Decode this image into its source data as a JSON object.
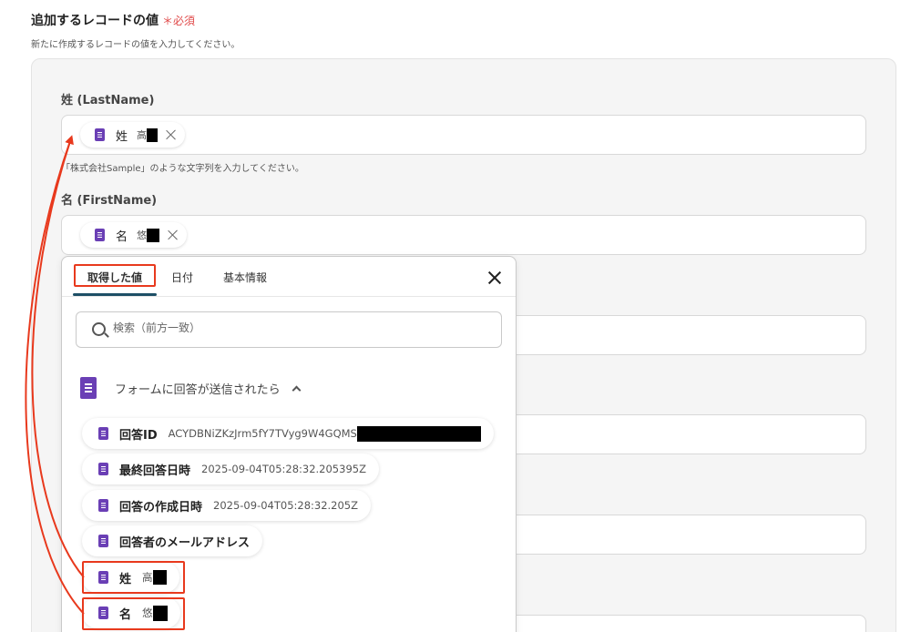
{
  "section": {
    "title": "追加するレコードの値",
    "required_mark": "＊",
    "required_label": "必須",
    "description": "新たに作成するレコードの値を入力してください。"
  },
  "fields": {
    "lastname": {
      "label": "姓 (LastName)",
      "chip_name": "姓",
      "chip_value": "高",
      "hint": "「株式会社Sample」のような文字列を入力してください。"
    },
    "firstname": {
      "label": "名 (FirstName)",
      "chip_name": "名",
      "chip_value": "悠"
    }
  },
  "popup": {
    "tabs": [
      "取得した値",
      "日付",
      "基本情報"
    ],
    "active_tab": "取得した値",
    "search_placeholder": "検索（前方一致）",
    "group_label": "フォームに回答が送信されたら",
    "items": [
      {
        "label": "回答ID",
        "value": "ACYDBNiZKzJrm5fY7TVyg9W4GQMS"
      },
      {
        "label": "最終回答日時",
        "value": "2025-09-04T05:28:32.205395Z"
      },
      {
        "label": "回答の作成日時",
        "value": "2025-09-04T05:28:32.205Z"
      },
      {
        "label": "回答者のメールアドレス",
        "value": ""
      },
      {
        "label": "姓",
        "value": "高"
      },
      {
        "label": "名",
        "value": "悠"
      }
    ]
  },
  "colors": {
    "accent_red": "#e8391d",
    "form_purple": "#6a3fb5",
    "tab_underline": "#1d4f66"
  }
}
